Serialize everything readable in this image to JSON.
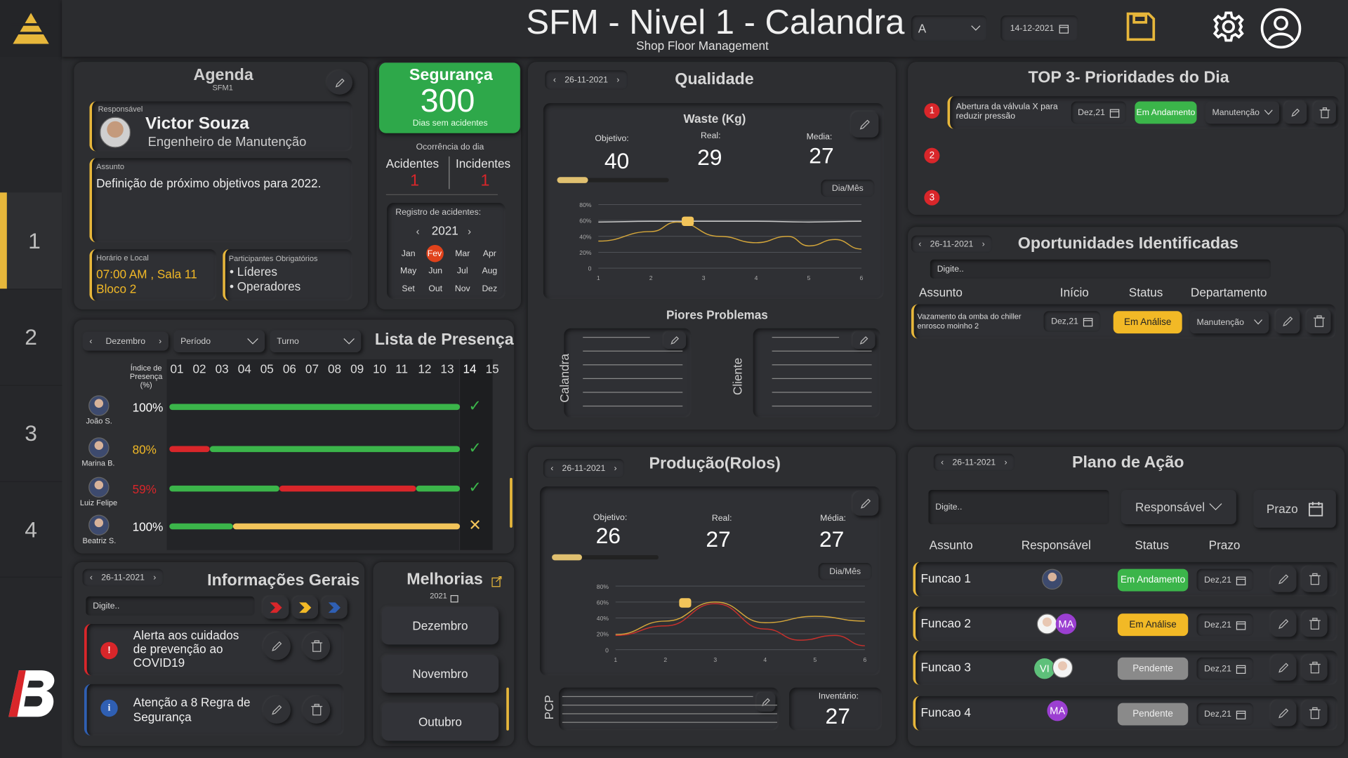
{
  "header": {
    "title": "SFM - Nivel 1 - Calandra",
    "subtitle": "Shop Floor Management",
    "shift_value": "A",
    "date_value": "14-12-2021"
  },
  "sidebar": {
    "items": [
      "1",
      "2",
      "3",
      "4"
    ],
    "active": "1"
  },
  "agenda": {
    "title": "Agenda",
    "subtitle": "SFM1",
    "responsavel_label": "Responsável",
    "name": "Victor Souza",
    "role": "Engenheiro de Manutenção",
    "assunto_label": "Assunto",
    "assunto": "Definição de próximo objetivos para 2022.",
    "horario_label": "Horário e Local",
    "horario": "07:00 AM , Sala 11",
    "local": "Bloco 2",
    "participantes_label": "Participantes Obrigatórios",
    "participantes": [
      "• Líderes",
      "• Operadores"
    ]
  },
  "seguranca": {
    "title": "Segurança",
    "count": "300",
    "caption": "Dias sem acidentes",
    "ocorrencia_label": "Ocorrência do dia",
    "acidentes_label": "Acidentes",
    "acidentes_value": "1",
    "incidentes_label": "Incidentes",
    "incidentes_value": "1",
    "registro_label": "Registro de acidentes:",
    "year": "2021",
    "months": [
      "Jan",
      "Fev",
      "Mar",
      "Apr",
      "May",
      "Jun",
      "Jul",
      "Aug",
      "Set",
      "Out",
      "Nov",
      "Dez"
    ],
    "highlight_month": "Fev"
  },
  "qualidade": {
    "date": "26-11-2021",
    "title": "Qualidade",
    "chart_title": "Waste (Kg)",
    "objetivo_label": "Objetivo:",
    "objetivo": "40",
    "real_label": "Real:",
    "real": "29",
    "media_label": "Media:",
    "media": "27",
    "period_button": "Dia/Mês",
    "objetivo_progress": 0.28,
    "piores_title": "Piores Problemas",
    "calandra_label": "Calandra",
    "cliente_label": "Cliente"
  },
  "top3": {
    "title": "TOP 3- Prioridades do Dia",
    "items": [
      {
        "num": "1",
        "text": "Abertura da válvula X para reduzir pressão",
        "date": "Dez,21",
        "status": "Em Andamento",
        "dept": "Manutenção"
      },
      {
        "num": "2"
      },
      {
        "num": "3"
      }
    ]
  },
  "oportunidades": {
    "date": "26-11-2021",
    "title": "Oportunidades Identificadas",
    "search_placeholder": "Digite..",
    "headers": [
      "Assunto",
      "Início",
      "Status",
      "Departamento"
    ],
    "rows": [
      {
        "assunto": "Vazamento da omba do chiller enrosco moinho 2",
        "date": "Dez,21",
        "status": "Em Análise",
        "dept": "Manutenção"
      }
    ]
  },
  "presenca": {
    "month": "Dezembro",
    "periodo": "Período",
    "turno": "Turno",
    "title": "Lista de Presença",
    "index_label": "Índice de Presença (%)",
    "days": [
      "01",
      "02",
      "03",
      "04",
      "05",
      "06",
      "07",
      "08",
      "09",
      "10",
      "11",
      "12",
      "13",
      "14",
      "15"
    ],
    "people": [
      {
        "name": "João S.",
        "pct": "100%",
        "pct_value": 100,
        "mark": "✓"
      },
      {
        "name": "Marina B.",
        "pct": "80%",
        "pct_value": 80,
        "mark": "✓"
      },
      {
        "name": "Luiz Felipe",
        "pct": "59%",
        "pct_value": 59,
        "mark": "✓"
      },
      {
        "name": "Beatriz S.",
        "pct": "100%",
        "pct_value": 100,
        "mark": "✕"
      }
    ]
  },
  "producao": {
    "date": "26-11-2021",
    "title": "Produção(Rolos)",
    "objetivo_label": "Objetivo:",
    "objetivo": "26",
    "real_label": "Real:",
    "real": "27",
    "media_label": "Média:",
    "media": "27",
    "period_button": "Dia/Mês",
    "objetivo_progress": 0.28,
    "pcp_label": "PCP",
    "inventario_label": "Inventário:",
    "inventario": "27"
  },
  "informacoes": {
    "date": "26-11-2021",
    "title": "Informações Gerais",
    "search_placeholder": "Digite..",
    "items": [
      {
        "text": "Alerta aos cuidados de prevenção ao COVID19",
        "type": "alert"
      },
      {
        "text": "Atenção a 8 Regra de Segurança",
        "type": "info"
      }
    ]
  },
  "melhorias": {
    "title": "Melhorias",
    "year": "2021",
    "months": [
      "Dezembro",
      "Novembro",
      "Outubro"
    ]
  },
  "plano": {
    "date": "26-11-2021",
    "title": "Plano de Ação",
    "search_placeholder": "Digite..",
    "responsavel_select": "Responsável",
    "prazo_button": "Prazo",
    "headers": [
      "Assunto",
      "Responsável",
      "Status",
      "Prazo"
    ],
    "rows": [
      {
        "assunto": "Funcao 1",
        "status": "Em Andamento",
        "date": "Dez,21"
      },
      {
        "assunto": "Funcao 2",
        "status": "Em Análise",
        "date": "Dez,21",
        "avatar_text": "MA"
      },
      {
        "assunto": "Funcao 3",
        "status": "Pendente",
        "date": "Dez,21",
        "avatar_text": "VI"
      },
      {
        "assunto": "Funcao 4",
        "status": "Pendente",
        "date": "Dez,21",
        "avatar_text": "MA"
      }
    ]
  },
  "colors": {
    "accent": "#e7b73b",
    "green": "#3bb54a",
    "red": "#d9262a",
    "amber": "#f2b926",
    "gray": "#777777"
  },
  "chart_data": [
    {
      "type": "line",
      "title": "Waste (Kg)",
      "x": [
        1,
        2,
        3,
        4,
        5,
        6
      ],
      "xlim": [
        1,
        6
      ],
      "ylim": [
        0,
        80
      ],
      "yticks": [
        "0",
        "20%",
        "40%",
        "60%",
        "80%"
      ],
      "series": [
        {
          "values": [
            58,
            59,
            59,
            59,
            58,
            59
          ]
        },
        {
          "values": [
            34,
            46,
            58,
            40,
            32,
            40,
            28,
            36,
            24
          ],
          "x": [
            1,
            2,
            2.5,
            3.3,
            4,
            4.6,
            5,
            5.5,
            6
          ]
        }
      ]
    },
    {
      "type": "line",
      "x": [
        1,
        2,
        3,
        4,
        5,
        6
      ],
      "xlim": [
        1,
        6
      ],
      "ylim": [
        0,
        80
      ],
      "yticks": [
        "0",
        "20%",
        "40%",
        "60%",
        "80%"
      ],
      "series": [
        {
          "values": [
            19,
            36,
            60,
            34,
            42,
            36
          ]
        },
        {
          "values": [
            18,
            30,
            58,
            26,
            12,
            18,
            5
          ],
          "x": [
            1,
            2,
            3,
            4,
            4.7,
            5.4,
            6
          ]
        }
      ]
    }
  ]
}
